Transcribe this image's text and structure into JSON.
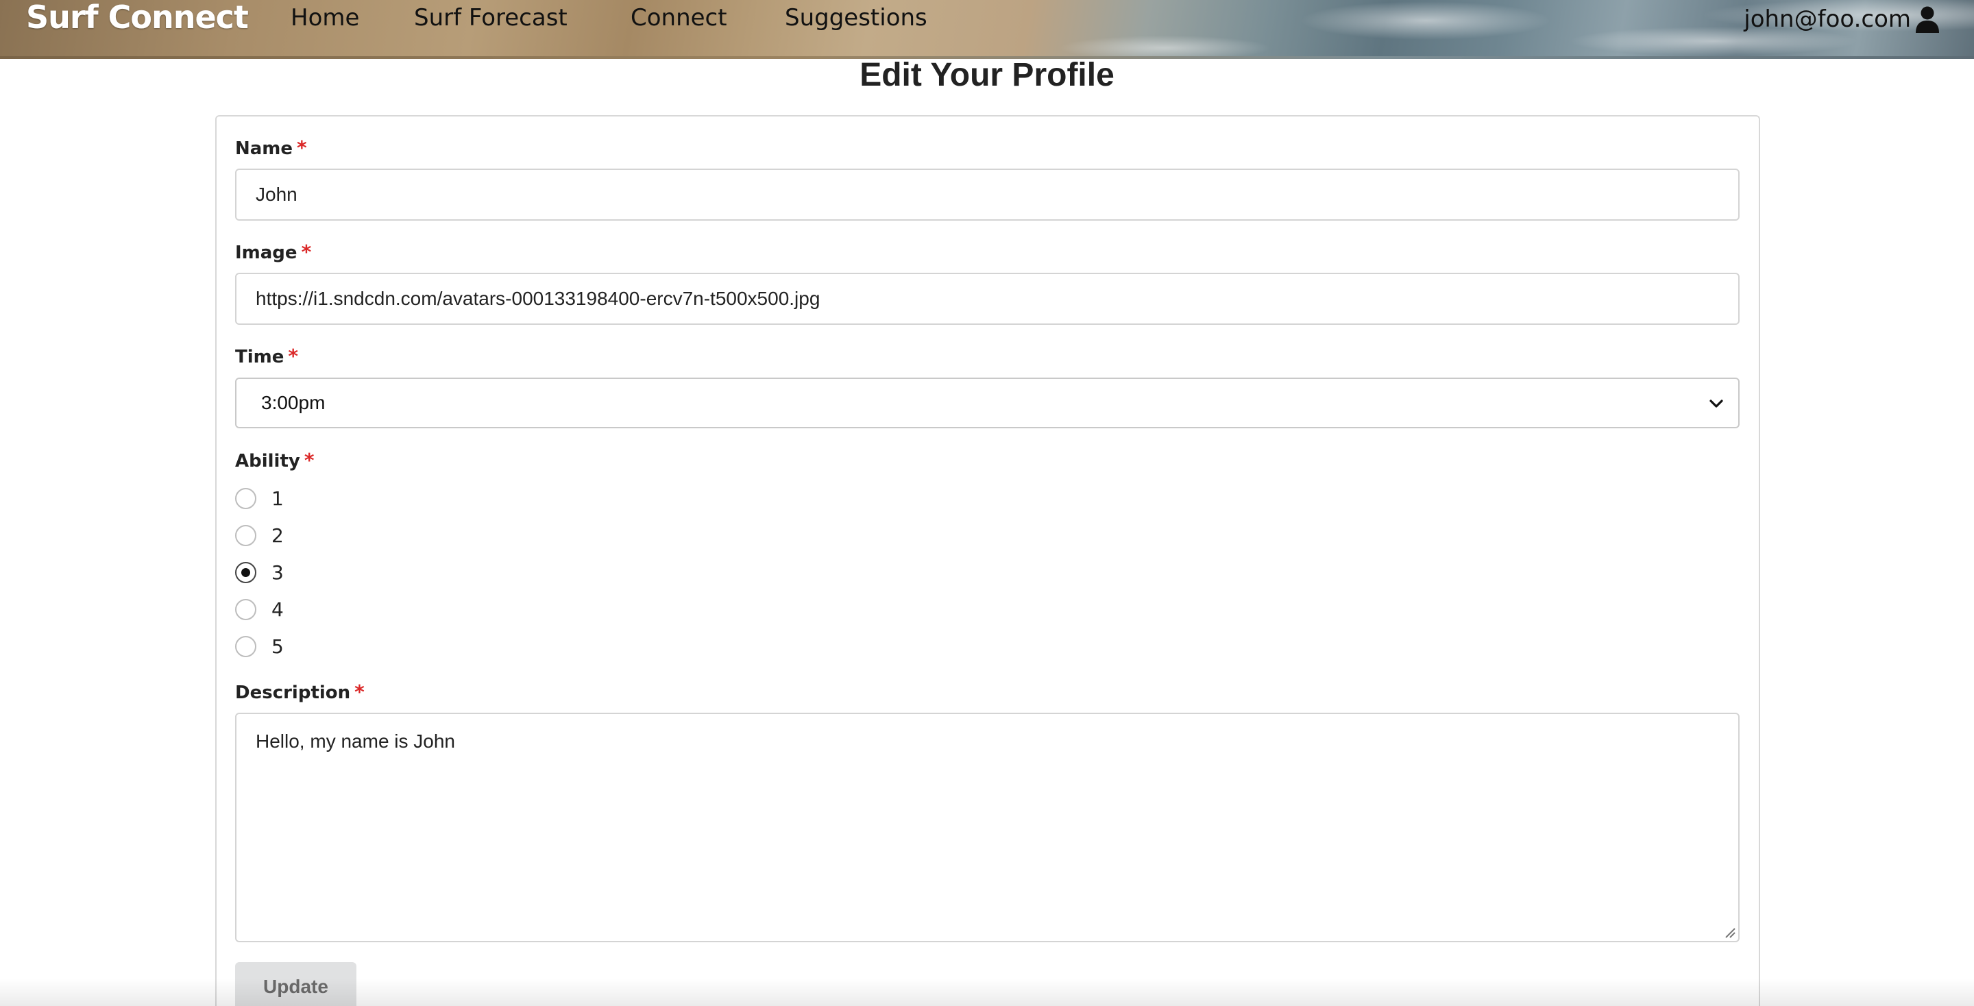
{
  "navbar": {
    "brand": "Surf Connect",
    "links": {
      "home": "Home",
      "forecast": "Surf Forecast",
      "connect": "Connect",
      "suggestions": "Suggestions"
    },
    "user_email": "john@foo.com",
    "user_icon": "user-icon"
  },
  "page": {
    "title": "Edit Your Profile"
  },
  "form": {
    "required_marker": "*",
    "name": {
      "label": "Name",
      "value": "John"
    },
    "image": {
      "label": "Image",
      "value": "https://i1.sndcdn.com/avatars-000133198400-ercv7n-t500x500.jpg"
    },
    "time": {
      "label": "Time",
      "selected": "3:00pm",
      "icon": "chevron-down-icon"
    },
    "ability": {
      "label": "Ability",
      "options": [
        "1",
        "2",
        "3",
        "4",
        "5"
      ],
      "selected": "3"
    },
    "description": {
      "label": "Description",
      "value": "Hello, my name is John"
    },
    "submit_label": "Update"
  },
  "colors": {
    "required": "#db2828",
    "button_bg": "#e0e1e2",
    "button_text": "#6a6a6a"
  }
}
